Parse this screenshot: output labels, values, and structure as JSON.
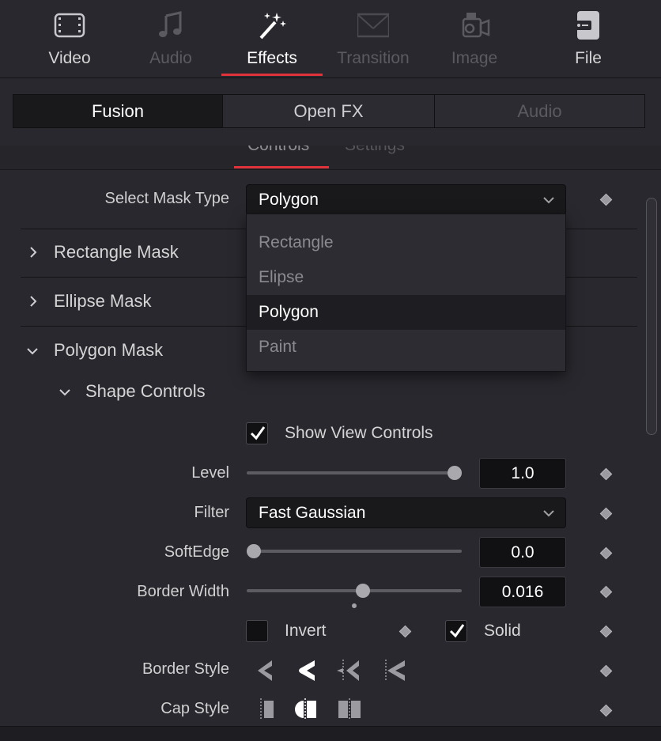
{
  "top_tabs": [
    {
      "label": "Video",
      "icon": "film-icon",
      "state": "normal"
    },
    {
      "label": "Audio",
      "icon": "music-note-icon",
      "state": "dim"
    },
    {
      "label": "Effects",
      "icon": "magic-wand-icon",
      "state": "active"
    },
    {
      "label": "Transition",
      "icon": "transition-icon",
      "state": "dim"
    },
    {
      "label": "Image",
      "icon": "camera-icon",
      "state": "dim"
    },
    {
      "label": "File",
      "icon": "file-tag-icon",
      "state": "normal"
    }
  ],
  "segments": {
    "fusion": "Fusion",
    "openfx": "Open FX",
    "audio": "Audio"
  },
  "subtabs": {
    "controls": "Controls",
    "settings": "Settings"
  },
  "mask_type": {
    "label": "Select Mask Type",
    "value": "Polygon"
  },
  "sections": {
    "rectangle": "Rectangle Mask",
    "ellipse": "Ellipse Mask",
    "polygon": "Polygon Mask",
    "shape_controls": "Shape Controls"
  },
  "dropdown_options": [
    "Rectangle",
    "Elipse",
    "Polygon",
    "Paint"
  ],
  "dropdown_selected": "Polygon",
  "show_view_controls": {
    "label": "Show View Controls",
    "checked": true
  },
  "level": {
    "label": "Level",
    "value": "1.0",
    "fraction": 1.0
  },
  "filter": {
    "label": "Filter",
    "value": "Fast Gaussian"
  },
  "softedge": {
    "label": "SoftEdge",
    "value": "0.0",
    "fraction": 0.0
  },
  "border_width": {
    "label": "Border Width",
    "value": "0.016",
    "fraction": 0.54
  },
  "invert": {
    "label": "Invert",
    "checked": false
  },
  "solid": {
    "label": "Solid",
    "checked": true
  },
  "border_style": {
    "label": "Border Style"
  },
  "cap_style": {
    "label": "Cap Style"
  },
  "colors": {
    "accent": "#e0323a",
    "background": "#28282e"
  }
}
